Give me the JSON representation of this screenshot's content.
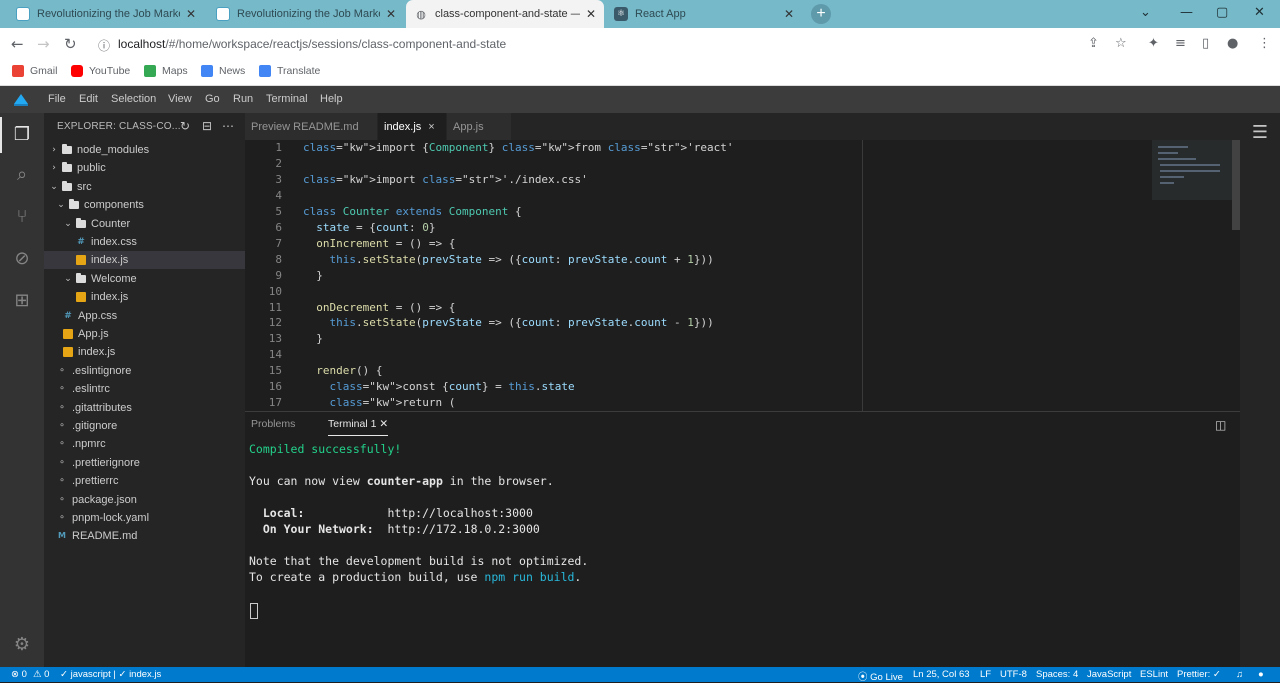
{
  "browser": {
    "tabs": [
      {
        "title": "Revolutionizing the Job Market",
        "active": false
      },
      {
        "title": "Revolutionizing the Job Market |",
        "active": false
      },
      {
        "title": "class-component-and-state — ...",
        "active": true
      },
      {
        "title": "React App",
        "active": false
      }
    ],
    "url_host": "localhost",
    "url_path": "/#/home/workspace/reactjs/sessions/class-component-and-state",
    "bookmarks": [
      "Gmail",
      "YouTube",
      "Maps",
      "News",
      "Translate"
    ]
  },
  "vscode": {
    "menu": [
      "File",
      "Edit",
      "Selection",
      "View",
      "Go",
      "Run",
      "Terminal",
      "Help"
    ],
    "explorer_title": "EXPLORER: CLASS-CO...",
    "tree": [
      {
        "label": "node_modules"
      },
      {
        "label": "public"
      },
      {
        "label": "src"
      },
      {
        "label": "components"
      },
      {
        "label": "Counter"
      },
      {
        "label": "index.css"
      },
      {
        "label": "index.js"
      },
      {
        "label": "Welcome"
      },
      {
        "label": "index.js"
      },
      {
        "label": "App.css"
      },
      {
        "label": "App.js"
      },
      {
        "label": "index.js"
      },
      {
        "label": ".eslintignore"
      },
      {
        "label": ".eslintrc"
      },
      {
        "label": ".gitattributes"
      },
      {
        "label": ".gitignore"
      },
      {
        "label": ".npmrc"
      },
      {
        "label": ".prettierignore"
      },
      {
        "label": ".prettierrc"
      },
      {
        "label": "package.json"
      },
      {
        "label": "pnpm-lock.yaml"
      },
      {
        "label": "README.md"
      }
    ],
    "editor_tabs": [
      "Preview README.md",
      "index.js",
      "App.js"
    ],
    "active_tab_close": "×",
    "line_numbers": [
      "1",
      "2",
      "3",
      "4",
      "5",
      "6",
      "7",
      "8",
      "9",
      "10",
      "11",
      "12",
      "13",
      "14",
      "15",
      "16",
      "17"
    ],
    "code_lines": [
      "import {Component} from 'react'",
      "",
      "import './index.css'",
      "",
      "class Counter extends Component {",
      "  state = {count: 0}",
      "  onIncrement = () => {",
      "    this.setState(prevState => ({count: prevState.count + 1}))",
      "  }",
      "",
      "  onDecrement = () => {",
      "    this.setState(prevState => ({count: prevState.count - 1}))",
      "  }",
      "",
      "  render() {",
      "    const {count} = this.state",
      "    return ("
    ],
    "panel_tabs": [
      "Problems",
      "Terminal 1"
    ],
    "terminal": {
      "compiled": "Compiled successfully!",
      "view_prefix": "You can now view ",
      "app_name": "counter-app",
      "view_suffix": " in the browser.",
      "local_label": "  Local:            ",
      "local_url": "http://localhost:3000",
      "network_label": "  On Your Network:  ",
      "network_url": "http://172.18.0.2:3000",
      "note": "Note that the development build is not optimized.",
      "create_prefix": "To create a production build, use ",
      "create_cmd": "npm run build",
      "create_suffix": "."
    },
    "status": {
      "errors": "⊗ 0",
      "warnings": "⚠ 0",
      "lang_file": "✓ javascript | ✓ index.js",
      "go_live": "Go Live",
      "position": "Ln 25, Col 63",
      "eol": "LF",
      "encoding": "UTF-8",
      "spaces": "Spaces: 4",
      "language": "JavaScript",
      "eslint": "ESLint",
      "prettier": "Prettier: ✓"
    }
  },
  "colors": {
    "accent": "#007acc",
    "chrome_bar": "#76b9c9",
    "editor_bg": "#1e1e1e"
  }
}
